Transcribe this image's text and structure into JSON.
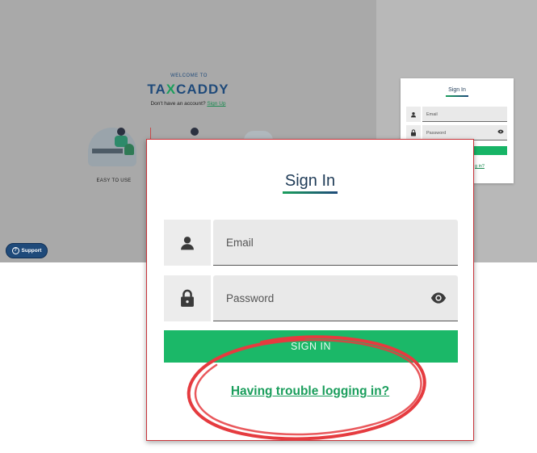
{
  "background": {
    "welcome_text": "WELCOME TO",
    "logo_prefix": "TA",
    "logo_x": "X",
    "logo_suffix": "CADDY",
    "no_account_text": "Don't have an account?",
    "signup_link": "Sign Up",
    "feature_label": "EASY TO USE",
    "support_button": "Support"
  },
  "mini_card": {
    "title": "Sign In",
    "email_placeholder": "Email",
    "password_placeholder": "Password",
    "trouble_link": "g in?"
  },
  "zoom_card": {
    "title": "Sign In",
    "email_placeholder": "Email",
    "password_placeholder": "Password",
    "signin_button": "SIGN IN",
    "trouble_link": "Having trouble logging in?"
  },
  "colors": {
    "brand_blue": "#1f4a7a",
    "brand_green": "#1a9e5c",
    "button_green": "#1bb868",
    "highlight_red": "#e53b3f",
    "card_border": "#c9353b",
    "overlay_gray": "#a9a9a9"
  },
  "icons": {
    "user": "user-icon",
    "lock": "lock-icon",
    "eye": "eye-icon",
    "help": "question-circle-icon"
  }
}
